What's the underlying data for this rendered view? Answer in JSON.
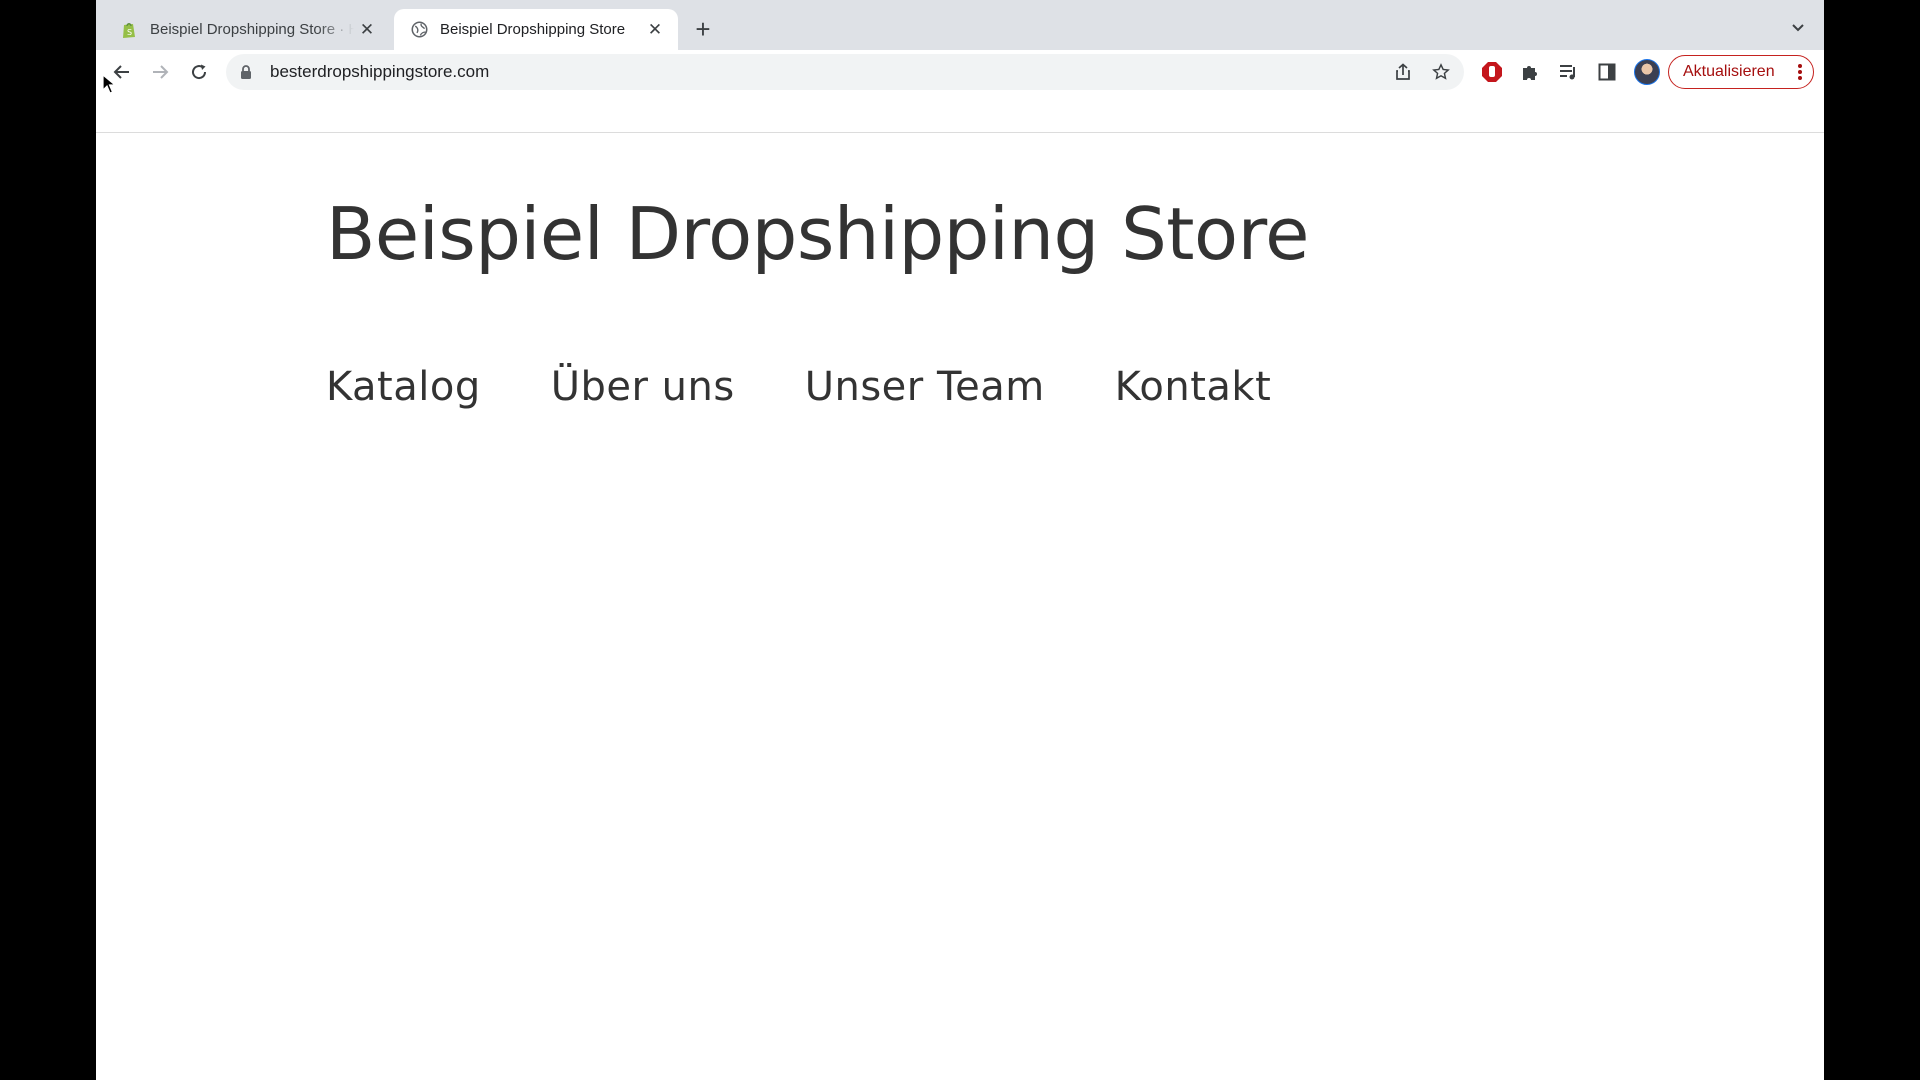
{
  "browser": {
    "tabs": [
      {
        "title": "Beispiel Dropshipping Store · H",
        "favicon": "shopify-icon",
        "active": false
      },
      {
        "title": "Beispiel Dropshipping Store",
        "favicon": "globe-icon",
        "active": true
      }
    ],
    "url": "besterdropshippingstore.com",
    "update_label": "Aktualisieren"
  },
  "site": {
    "title": "Beispiel Dropshipping Store",
    "nav": [
      "Katalog",
      "Über uns",
      "Unser Team",
      "Kontakt"
    ]
  },
  "colors": {
    "accent_update": "#c5221f",
    "text": "#333333"
  }
}
